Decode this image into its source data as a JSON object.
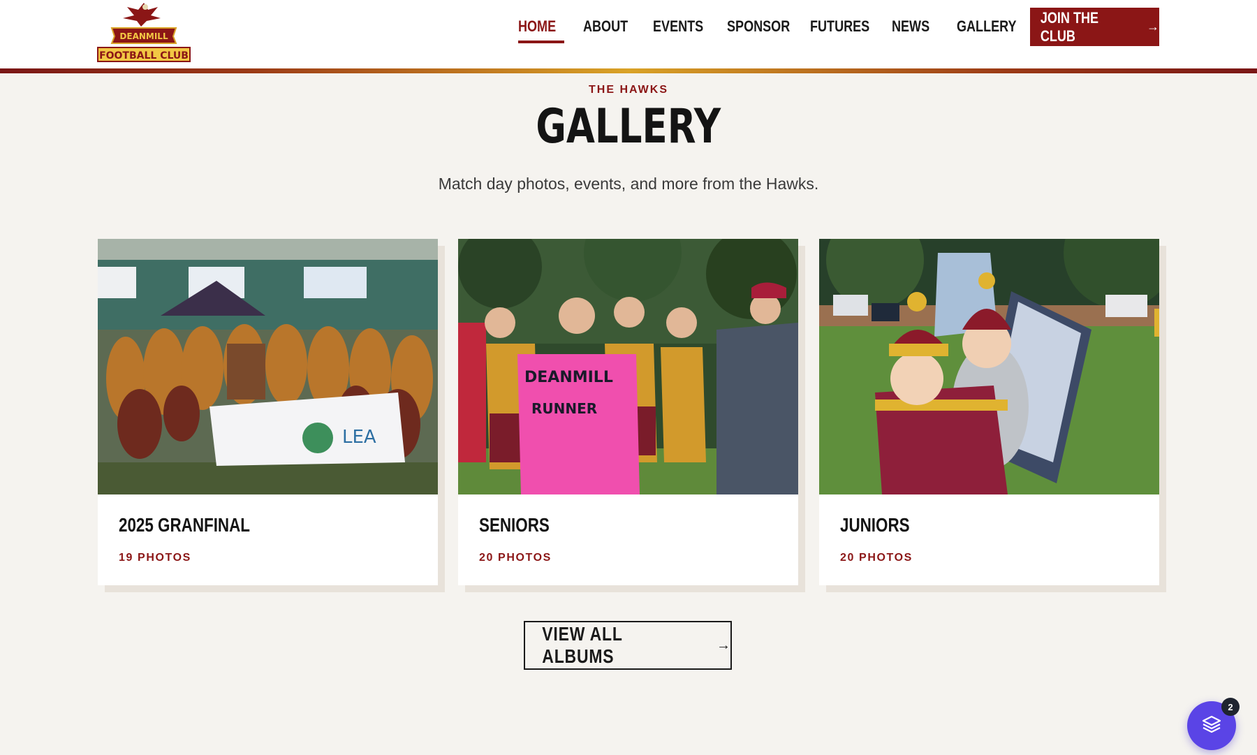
{
  "header": {
    "logo": {
      "top_text": "DEANMILL",
      "bottom_text": "FOOTBALL CLUB"
    },
    "nav": [
      {
        "label": "HOME",
        "active": true
      },
      {
        "label": "ABOUT",
        "active": false
      },
      {
        "label": "EVENTS",
        "active": false
      },
      {
        "label": "SPONSOR",
        "active": false
      },
      {
        "label": "FUTURES",
        "active": false
      },
      {
        "label": "NEWS",
        "active": false
      },
      {
        "label": "GALLERY",
        "active": false
      }
    ],
    "cta": {
      "label": "JOIN THE CLUB",
      "icon": "arrow-right-icon"
    }
  },
  "section": {
    "eyebrow": "THE HAWKS",
    "title": "GALLERY",
    "subtitle": "Match day photos, events, and more from the Hawks."
  },
  "albums": [
    {
      "title": "2025 GRANFINAL",
      "count": "19 PHOTOS"
    },
    {
      "title": "SENIORS",
      "count": "20 PHOTOS"
    },
    {
      "title": "JUNIORS",
      "count": "20 PHOTOS"
    }
  ],
  "view_all": {
    "label": "VIEW ALL ALBUMS",
    "icon": "arrow-right-icon"
  },
  "widget": {
    "badge": "2",
    "icon": "layers-icon"
  },
  "colors": {
    "brand": "#8b1616",
    "gold": "#d9a227",
    "background": "#f5f3ef",
    "widget": "#5a44e6"
  }
}
